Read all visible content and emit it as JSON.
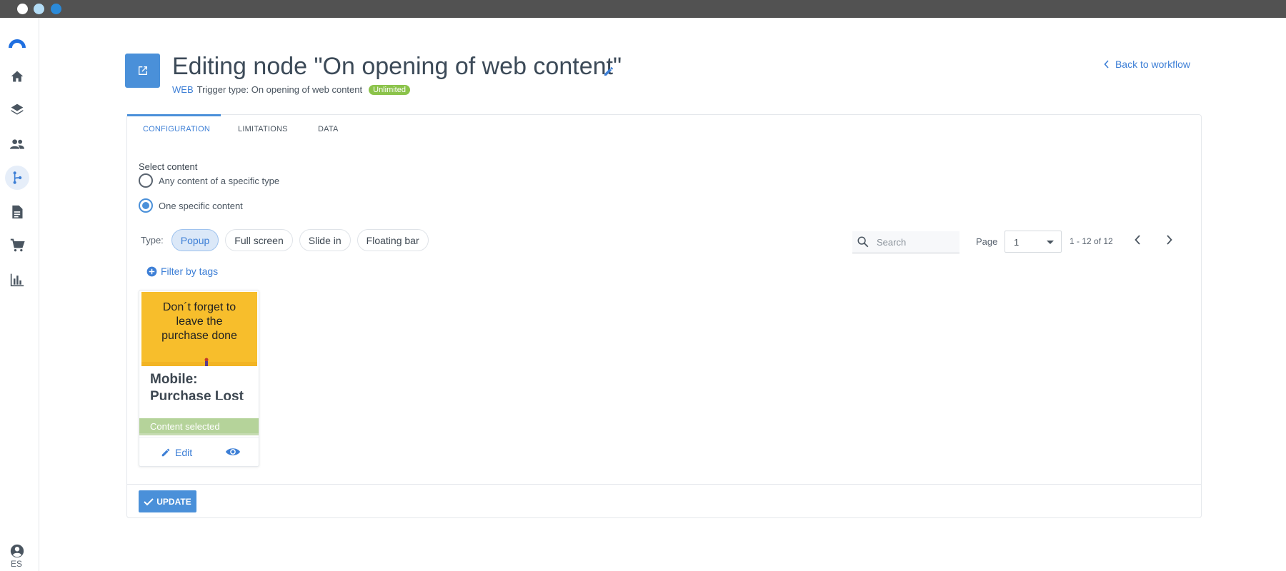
{
  "window": {
    "dots": [
      "#ffffff",
      "#b3dcf5",
      "#2b8ad8"
    ]
  },
  "sidebar": {
    "items": [
      {
        "icon": "home-icon"
      },
      {
        "icon": "layers-icon"
      },
      {
        "icon": "people-icon"
      },
      {
        "icon": "workflow-icon",
        "active": true
      },
      {
        "icon": "document-icon"
      },
      {
        "icon": "cart-icon"
      },
      {
        "icon": "bar-chart-icon"
      }
    ],
    "language": "ES"
  },
  "header": {
    "title": "Editing node \"On opening of web content\"",
    "channel": "WEB",
    "trigger_text": "Trigger type: On opening of web content",
    "badge": "Unlimited",
    "back_label": "Back to workflow"
  },
  "tabs": [
    {
      "label": "CONFIGURATION",
      "active": true
    },
    {
      "label": "LIMITATIONS"
    },
    {
      "label": "DATA"
    }
  ],
  "config": {
    "select_label": "Select content",
    "options": [
      {
        "label": "Any content of a specific type",
        "selected": false
      },
      {
        "label": "One specific content",
        "selected": true
      }
    ],
    "type_label": "Type:",
    "types": [
      {
        "label": "Popup",
        "selected": true
      },
      {
        "label": "Full screen"
      },
      {
        "label": "Slide in"
      },
      {
        "label": "Floating bar"
      }
    ],
    "filter_tags": "Filter by tags",
    "search_placeholder": "Search",
    "page_label": "Page",
    "page_value": "1",
    "range": "1 - 12 of 12"
  },
  "content_card": {
    "thumb_text": "Don´t forget to leave the purchase done",
    "name": "Mobile: Purchase Lost",
    "status": "Content selected",
    "edit": "Edit"
  },
  "footer": {
    "update": "UPDATE"
  },
  "colors": {
    "accent": "#4a90d9",
    "badge": "#8bc34a",
    "thumb": "#f7be2c"
  }
}
